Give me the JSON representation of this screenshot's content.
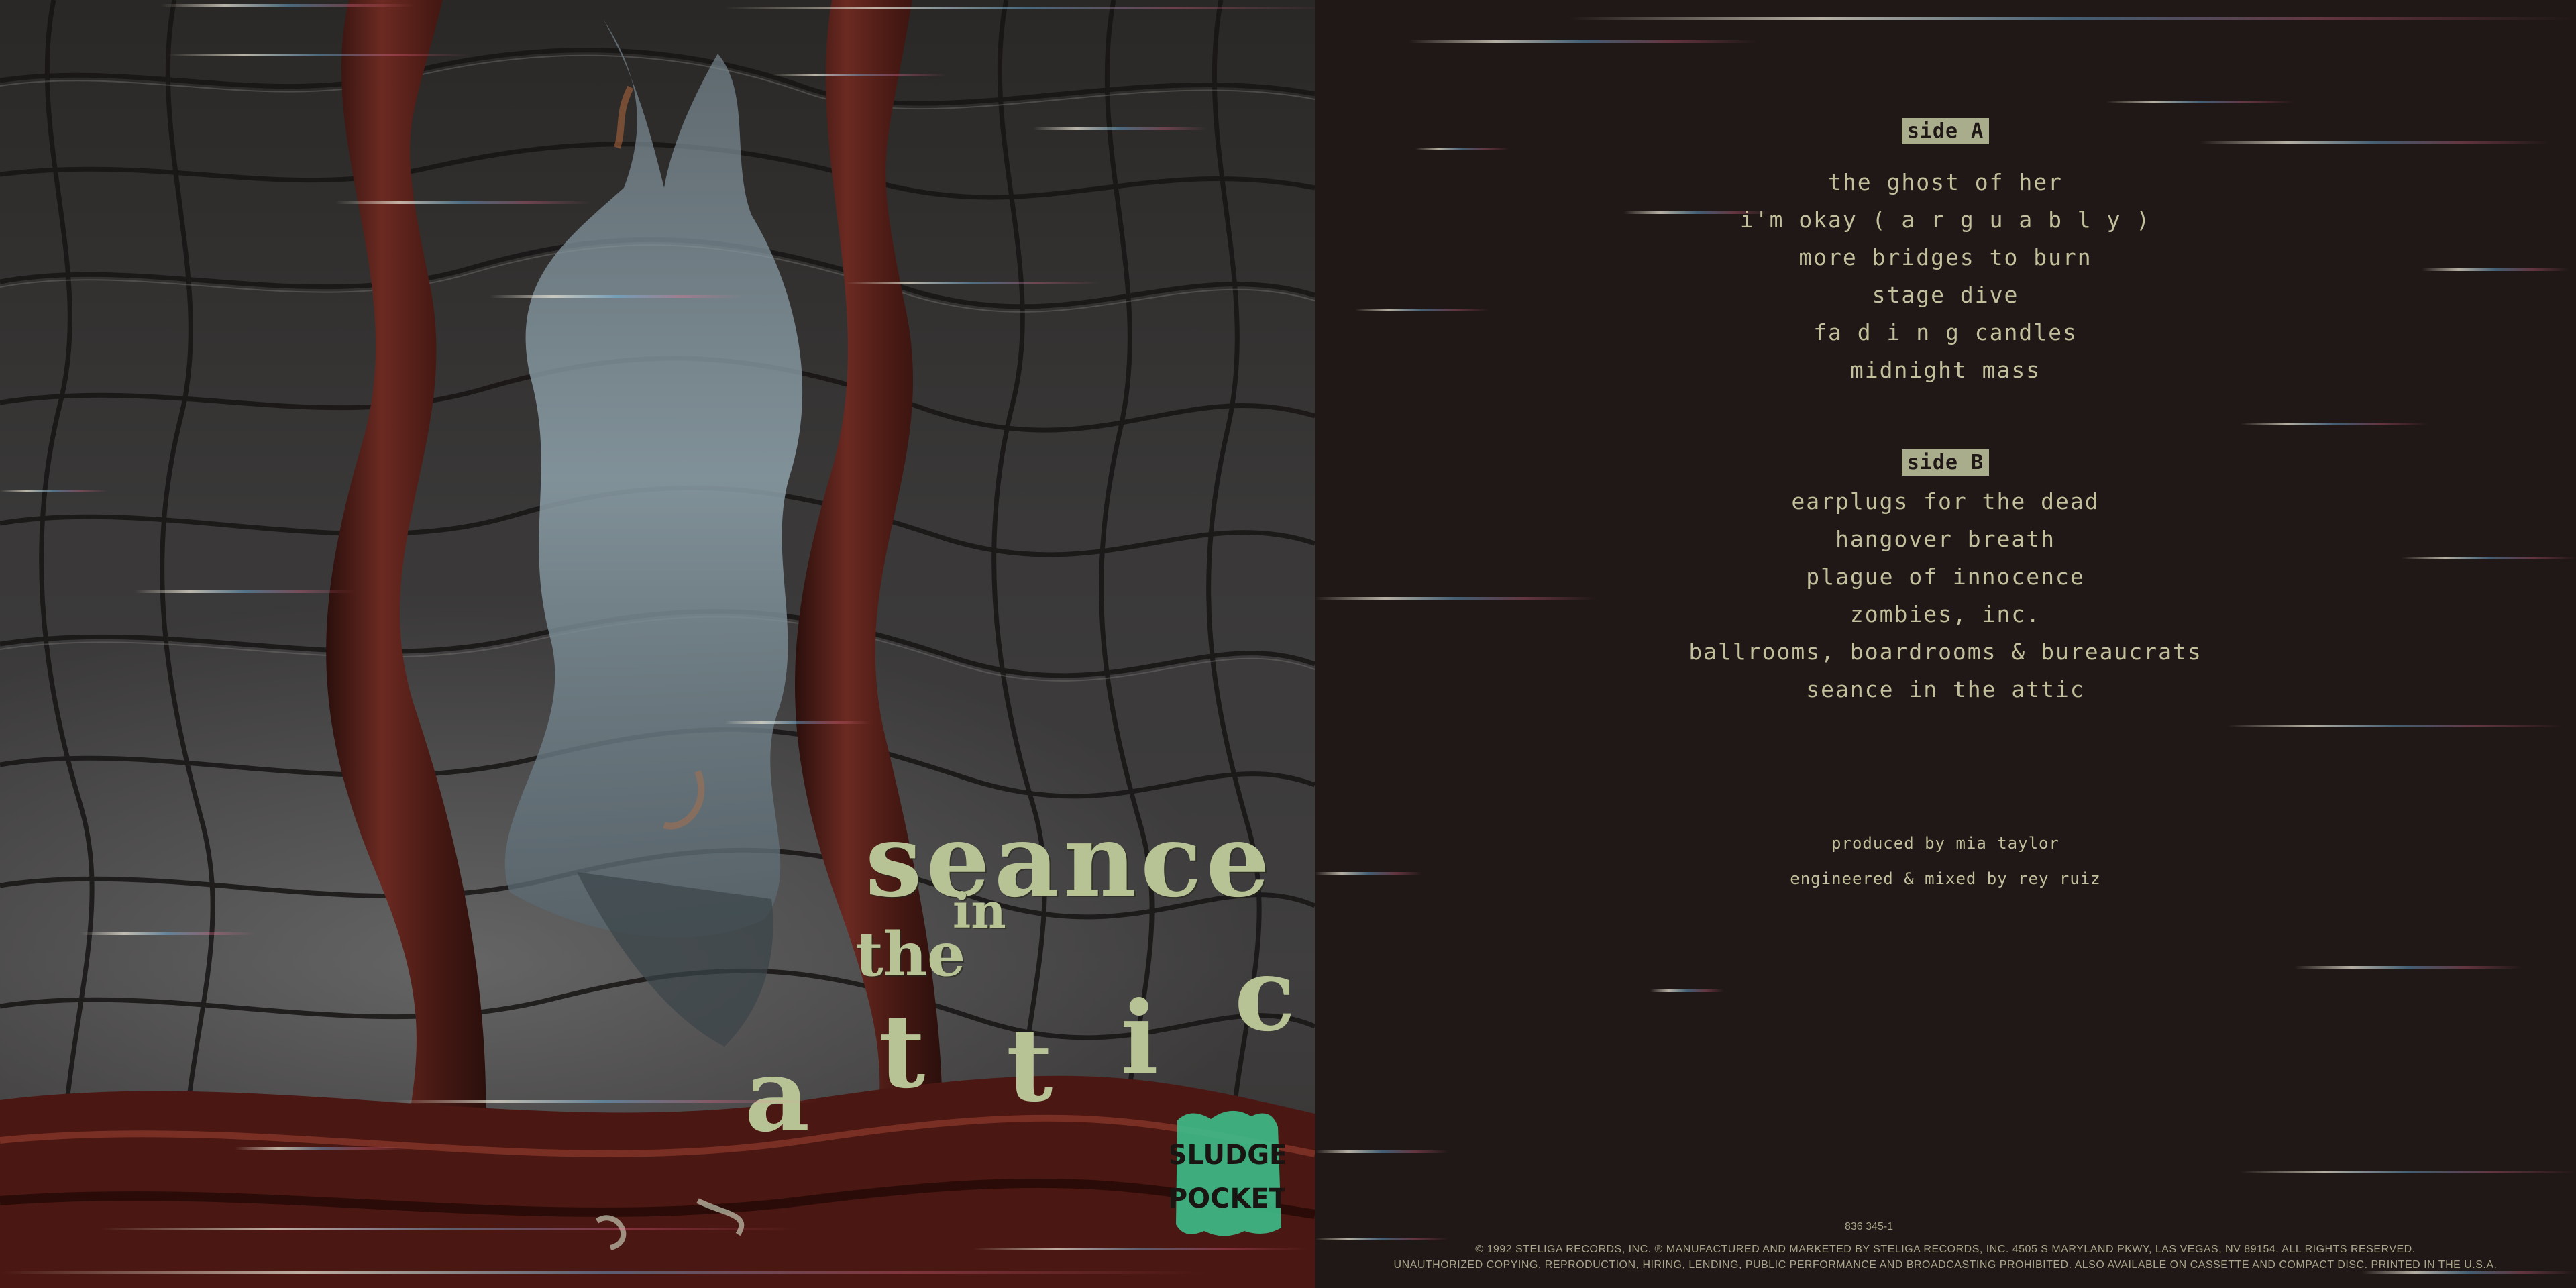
{
  "cover": {
    "title_word_1": "seance",
    "title_word_2": "in",
    "title_word_3": "the",
    "title_word_4_letters": [
      "a",
      "t",
      "t",
      "i",
      "c"
    ],
    "logo_text": "SLUDGE POCKET"
  },
  "back": {
    "side_a_label": "side A",
    "side_a_tracks": [
      "the ghost of her",
      "i'm okay ( a r g u a b l y )",
      "more bridges to burn",
      "stage dive",
      "fa d i n  g candles",
      "midnight mass"
    ],
    "side_b_label": "side B",
    "side_b_tracks": [
      "earplugs for the dead",
      "hangover breath",
      "plague of innocence",
      "zombies, inc.",
      "ballrooms, boardrooms & bureaucrats",
      "seance in the attic"
    ],
    "producer_credit": "produced by mia taylor",
    "engineer_credit": "engineered & mixed by rey ruiz",
    "catalog_number": "836 345-1",
    "copyright_line": "© 1992 STELIGA RECORDS, INC.  ℗ MANUFACTURED AND MARKETED BY STELIGA RECORDS, INC. 4505 S MARYLAND PKWY, LAS VEGAS, NV 89154. ALL RIGHTS RESERVED.",
    "legal_line": "UNAUTHORIZED COPYING, REPRODUCTION, HIRING, LENDING, PUBLIC PERFORMANCE AND BROADCASTING PROHIBITED. ALSO AVAILABLE ON CASSETTE AND COMPACT DISC. PRINTED IN THE U.S.A."
  },
  "colors": {
    "back_background": "#201816",
    "text": "#c2bf9c",
    "cover_title": "#b8c395",
    "logo_green": "#3dbd8a"
  }
}
